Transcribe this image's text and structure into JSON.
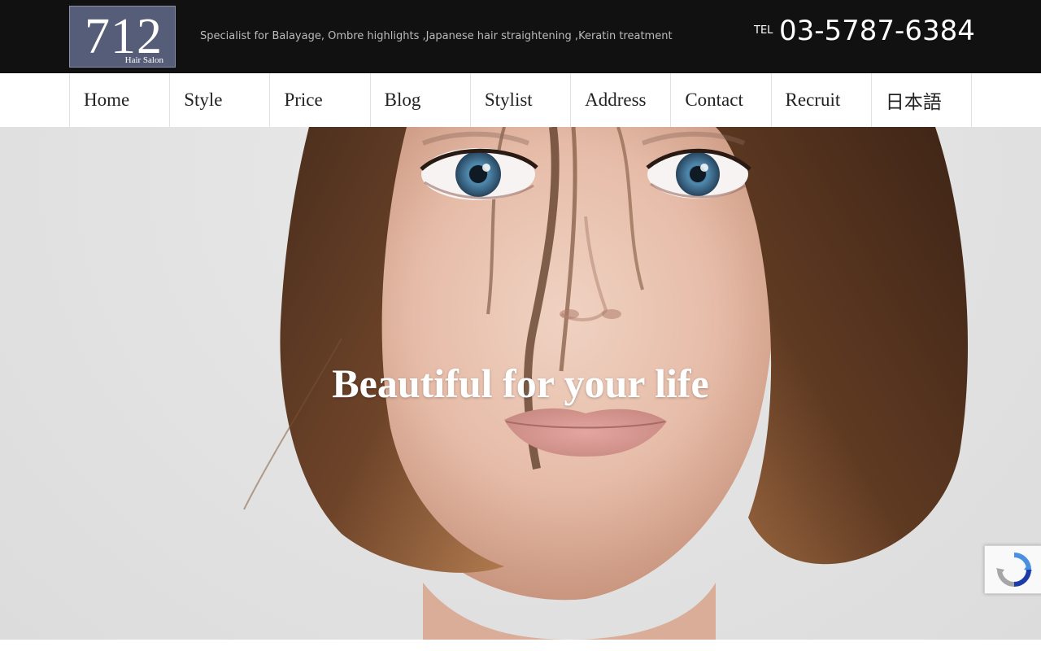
{
  "header": {
    "logo": {
      "number": "712",
      "subtitle": "Hair Salon"
    },
    "tagline": "Specialist for Balayage, Ombre highlights ,Japanese hair straightening ,Keratin treatment",
    "tel_prefix": "TEL",
    "tel_number": "03-5787-6384"
  },
  "nav": {
    "items": [
      {
        "label": "Home"
      },
      {
        "label": "Style"
      },
      {
        "label": "Price"
      },
      {
        "label": "Blog"
      },
      {
        "label": "Stylist"
      },
      {
        "label": "Address"
      },
      {
        "label": "Contact"
      },
      {
        "label": "Recruit"
      },
      {
        "label": "日本語"
      }
    ]
  },
  "hero": {
    "headline": "Beautiful for your life"
  },
  "recaptcha": {
    "icon": "recaptcha-icon"
  },
  "colors": {
    "topbar": "#111111",
    "logo_bg": "#565d78",
    "nav_text": "#222222",
    "hero_text": "#ffffff"
  }
}
